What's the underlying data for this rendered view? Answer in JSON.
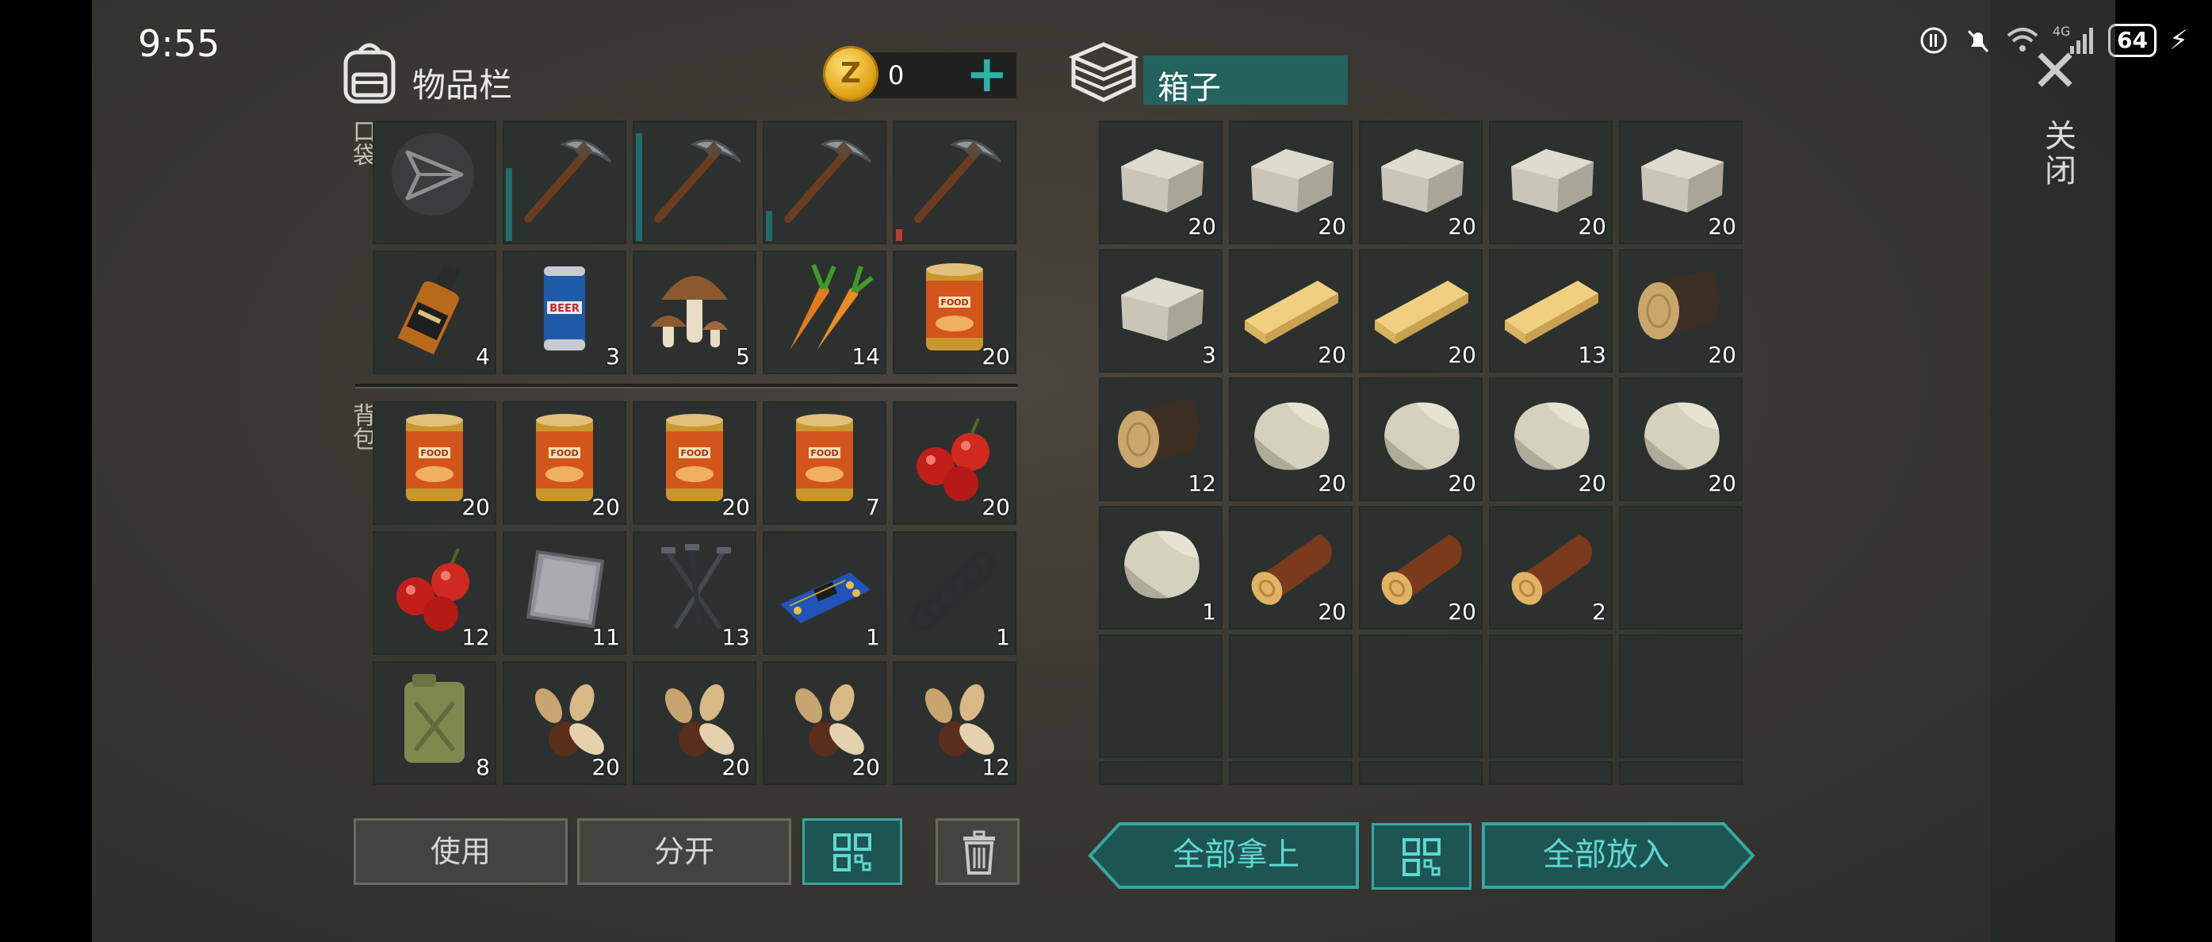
{
  "status_bar": {
    "time": "9:55",
    "battery": "64",
    "network": "4G"
  },
  "inventory": {
    "title": "物品栏",
    "coins": "0",
    "pockets_label": "口袋",
    "backpack_label": "背包",
    "pockets_rows": [
      [
        {
          "item": "send-icon",
          "count": ""
        },
        {
          "item": "pickaxe",
          "count": "",
          "durability": 0.62
        },
        {
          "item": "pickaxe",
          "count": "",
          "durability": 0.92
        },
        {
          "item": "pickaxe",
          "count": "",
          "durability": 0.26
        },
        {
          "item": "pickaxe",
          "count": "",
          "durability": 0.1,
          "durability_color": "#c0392b"
        }
      ],
      [
        {
          "item": "whiskey-bottle",
          "count": "4"
        },
        {
          "item": "beer-can",
          "count": "3"
        },
        {
          "item": "mushrooms",
          "count": "5"
        },
        {
          "item": "carrots",
          "count": "14"
        },
        {
          "item": "food-can",
          "count": "20"
        }
      ]
    ],
    "backpack_rows": [
      [
        {
          "item": "food-can",
          "count": "20"
        },
        {
          "item": "food-can",
          "count": "20"
        },
        {
          "item": "food-can",
          "count": "20"
        },
        {
          "item": "food-can",
          "count": "7"
        },
        {
          "item": "berries",
          "count": "20"
        }
      ],
      [
        {
          "item": "berries",
          "count": "12"
        },
        {
          "item": "metal-plate",
          "count": "11"
        },
        {
          "item": "nails",
          "count": "13"
        },
        {
          "item": "circuit-board",
          "count": "1"
        },
        {
          "item": "spring",
          "count": "1"
        }
      ],
      [
        {
          "item": "jerrycan",
          "count": "8"
        },
        {
          "item": "seeds",
          "count": "20"
        },
        {
          "item": "seeds",
          "count": "20"
        },
        {
          "item": "seeds",
          "count": "20"
        },
        {
          "item": "seeds",
          "count": "12"
        }
      ]
    ],
    "buttons": {
      "use": "使用",
      "split": "分开"
    }
  },
  "box": {
    "title": "箱子",
    "rows": [
      [
        {
          "item": "stone-block",
          "count": "20"
        },
        {
          "item": "stone-block",
          "count": "20"
        },
        {
          "item": "stone-block",
          "count": "20"
        },
        {
          "item": "stone-block",
          "count": "20"
        },
        {
          "item": "stone-block",
          "count": "20"
        }
      ],
      [
        {
          "item": "stone-block",
          "count": "3"
        },
        {
          "item": "wood-plank",
          "count": "20"
        },
        {
          "item": "wood-plank",
          "count": "20"
        },
        {
          "item": "wood-plank",
          "count": "13"
        },
        {
          "item": "oak-log",
          "count": "20"
        }
      ],
      [
        {
          "item": "oak-log",
          "count": "12"
        },
        {
          "item": "stone",
          "count": "20"
        },
        {
          "item": "stone",
          "count": "20"
        },
        {
          "item": "stone",
          "count": "20"
        },
        {
          "item": "stone",
          "count": "20"
        }
      ],
      [
        {
          "item": "stone",
          "count": "1"
        },
        {
          "item": "pine-log",
          "count": "20"
        },
        {
          "item": "pine-log",
          "count": "20"
        },
        {
          "item": "pine-log",
          "count": "2"
        },
        {
          "item": "",
          "count": ""
        }
      ],
      [
        {
          "item": "",
          "count": ""
        },
        {
          "item": "",
          "count": ""
        },
        {
          "item": "",
          "count": ""
        },
        {
          "item": "",
          "count": ""
        },
        {
          "item": "",
          "count": ""
        }
      ]
    ],
    "buttons": {
      "take_all": "全部拿上",
      "put_all": "全部放入"
    }
  },
  "close_label": "关闭",
  "colors": {
    "accent": "#2bb3a8",
    "slot": "#2c302f",
    "teal_button": "#1d5552"
  }
}
